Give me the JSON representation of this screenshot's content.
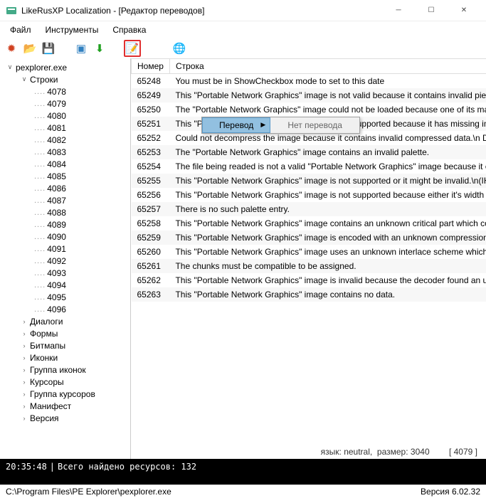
{
  "window": {
    "title": "LikeRusXP Localization - [Редактор переводов]"
  },
  "menu": [
    "Файл",
    "Инструменты",
    "Справка"
  ],
  "toolbar": {
    "items": [
      {
        "name": "new-icon",
        "glyph": "✹",
        "color": "#d04020"
      },
      {
        "name": "open-icon",
        "glyph": "📂",
        "color": "#c08020"
      },
      {
        "name": "save-icon",
        "glyph": "💾",
        "color": "#4060a0"
      },
      {
        "name": "sep"
      },
      {
        "name": "window-icon",
        "glyph": "▣",
        "color": "#3080c0"
      },
      {
        "name": "download-icon",
        "glyph": "⬇",
        "color": "#20a020"
      },
      {
        "name": "sep"
      },
      {
        "name": "edit-icon",
        "glyph": "📝",
        "color": "#604020",
        "hl": true
      },
      {
        "name": "sep"
      },
      {
        "name": "sep"
      },
      {
        "name": "globe-icon",
        "glyph": "🌐",
        "color": "#2080c0"
      }
    ]
  },
  "tree": {
    "root": "pexplorer.exe",
    "strings_label": "Строки",
    "string_ids": [
      "4078",
      "4079",
      "4080",
      "4081",
      "4082",
      "4083",
      "4084",
      "4085",
      "4086",
      "4087",
      "4088",
      "4089",
      "4090",
      "4091",
      "4092",
      "4093",
      "4094",
      "4095",
      "4096"
    ],
    "groups": [
      "Диалоги",
      "Формы",
      "Битмапы",
      "Иконки",
      "Группа иконок",
      "Курсоры",
      "Группа курсоров",
      "Манифест",
      "Версия"
    ]
  },
  "table": {
    "headers": [
      "Номер",
      "Строка"
    ],
    "rows": [
      {
        "n": "65248",
        "s": "You must be in ShowCheckbox mode to set to this date"
      },
      {
        "n": "65249",
        "s": "This \"Portable Network Graphics\" image is not valid because it contains invalid pieces of d"
      },
      {
        "n": "65250",
        "s": "The \"Portable Network Graphics\" image could not be loaded because one of its main piec"
      },
      {
        "n": "65251",
        "s": "This \"Portable Network Graphics\" image is not supported because it has missing image parts."
      },
      {
        "n": "65252",
        "s": "Could not decompress the image because it contains invalid compressed data.\\n Descript"
      },
      {
        "n": "65253",
        "s": "The \"Portable Network Graphics\" image contains an invalid palette."
      },
      {
        "n": "65254",
        "s": "The file being readed is not a valid \"Portable Network Graphics\" image because it contains"
      },
      {
        "n": "65255",
        "s": "This \"Portable Network Graphics\" image is not supported or it might be invalid.\\n(IHDR ch"
      },
      {
        "n": "65256",
        "s": "This \"Portable Network Graphics\" image is not supported because either it's width or heig"
      },
      {
        "n": "65257",
        "s": "There is no such palette entry."
      },
      {
        "n": "65258",
        "s": "This \"Portable Network Graphics\" image contains an unknown critical part which could no"
      },
      {
        "n": "65259",
        "s": "This \"Portable Network Graphics\" image is encoded with an unknown compression schem"
      },
      {
        "n": "65260",
        "s": "This \"Portable Network Graphics\" image uses an unknown interlace scheme which could"
      },
      {
        "n": "65261",
        "s": "The chunks must be compatible to be assigned."
      },
      {
        "n": "65262",
        "s": "This \"Portable Network Graphics\" image is invalid because the decoder found an unexpec"
      },
      {
        "n": "65263",
        "s": "This \"Portable Network Graphics\" image contains no data."
      }
    ]
  },
  "context_menu": {
    "translate": "Перевод",
    "no_translate": "Нет перевода"
  },
  "info": {
    "lang_label": "язык:",
    "lang": "neutral",
    "size_label": "размер:",
    "size": "3040",
    "sel": "[ 4079 ]"
  },
  "console": {
    "time": "20:35:48",
    "msg": "Всего найдено ресурсов: 132"
  },
  "status": {
    "path": "C:\\Program Files\\PE Explorer\\pexplorer.exe",
    "version_label": "Версия",
    "version": "6.02.32"
  }
}
